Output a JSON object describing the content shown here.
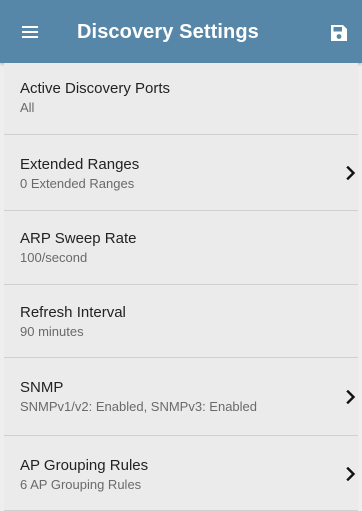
{
  "header": {
    "title": "Discovery Settings",
    "menu_icon": "hamburger-menu-icon",
    "save_icon": "floppy-disk-save-icon",
    "color": "#5787a8"
  },
  "settings": [
    {
      "title": "Active Discovery Ports",
      "value": "All",
      "has_chevron": false
    },
    {
      "title": "Extended Ranges",
      "value": "0 Extended Ranges",
      "has_chevron": true
    },
    {
      "title": "ARP Sweep Rate",
      "value": "100/second",
      "has_chevron": false
    },
    {
      "title": "Refresh Interval",
      "value": "90 minutes",
      "has_chevron": false
    },
    {
      "title": "SNMP",
      "value": "SNMPv1/v2:  Enabled,  SNMPv3:  Enabled",
      "has_chevron": true
    },
    {
      "title": "AP Grouping Rules",
      "value": "6 AP Grouping Rules",
      "has_chevron": true
    }
  ]
}
